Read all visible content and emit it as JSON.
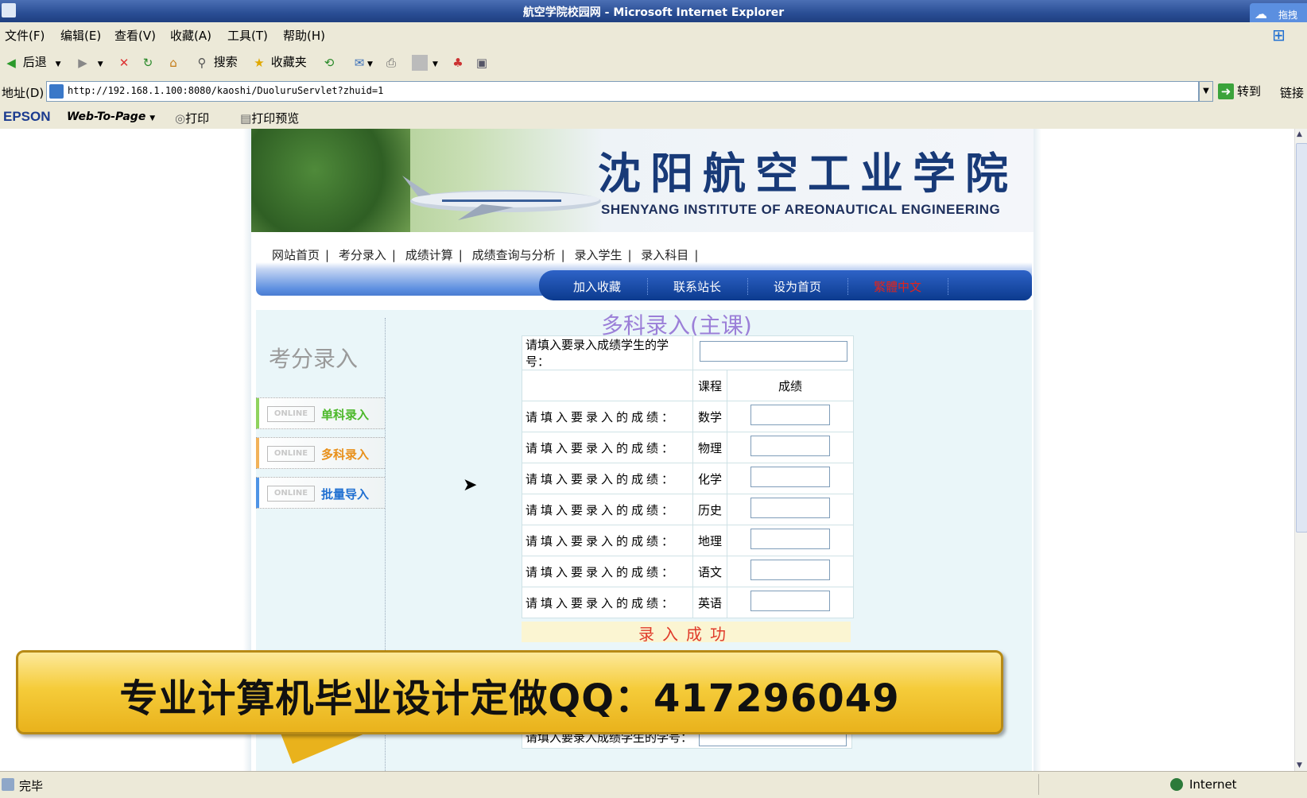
{
  "window": {
    "title": "航空学院校园网 - Microsoft Internet Explorer",
    "cloud_label": "拖拽"
  },
  "menu": [
    "文件(F)",
    "编辑(E)",
    "查看(V)",
    "收藏(A)",
    "工具(T)",
    "帮助(H)"
  ],
  "toolbar": {
    "back": "后退",
    "search": "搜索",
    "favorites": "收藏夹"
  },
  "address": {
    "label": "地址(D)",
    "url": "http://192.168.1.100:8080/kaoshi/DuoluruServlet?zhuid=1",
    "go": "转到",
    "links": "链接"
  },
  "epson": {
    "logo": "EPSON",
    "webtopage": "Web-To-Page",
    "print": "打印",
    "preview": "打印预览"
  },
  "banner": {
    "name_zh": "沈阳航空工业学院",
    "name_en": "SHENYANG INSTITUTE OF AREONAUTICAL ENGINEERING"
  },
  "nav": [
    "网站首页",
    "考分录入",
    "成绩计算",
    "成绩查询与分析",
    "录入学生",
    "录入科目"
  ],
  "tabs": [
    "加入收藏",
    "联系站长",
    "设为首页",
    "繁體中文"
  ],
  "sidebar": {
    "title": "考分录入",
    "online": "ONLINE",
    "items": [
      {
        "label": "单科录入",
        "color": "#4cb82a"
      },
      {
        "label": "多科录入",
        "color": "#e8901a"
      },
      {
        "label": "批量导入",
        "color": "#1f6fd1"
      }
    ]
  },
  "form": {
    "title": "多科录入(主课)",
    "id_prompt": "请填入要录入成绩学生的学号：",
    "col_course": "课程",
    "col_score": "成绩",
    "row_prompt": "请填入要录入的成绩：",
    "subjects": [
      "数学",
      "物理",
      "化学",
      "历史",
      "地理",
      "语文",
      "英语"
    ],
    "success": "录入成功"
  },
  "promo": {
    "text": "专业计算机毕业设计定做QQ：417296049"
  },
  "status": {
    "text": "完毕",
    "zone": "Internet"
  }
}
